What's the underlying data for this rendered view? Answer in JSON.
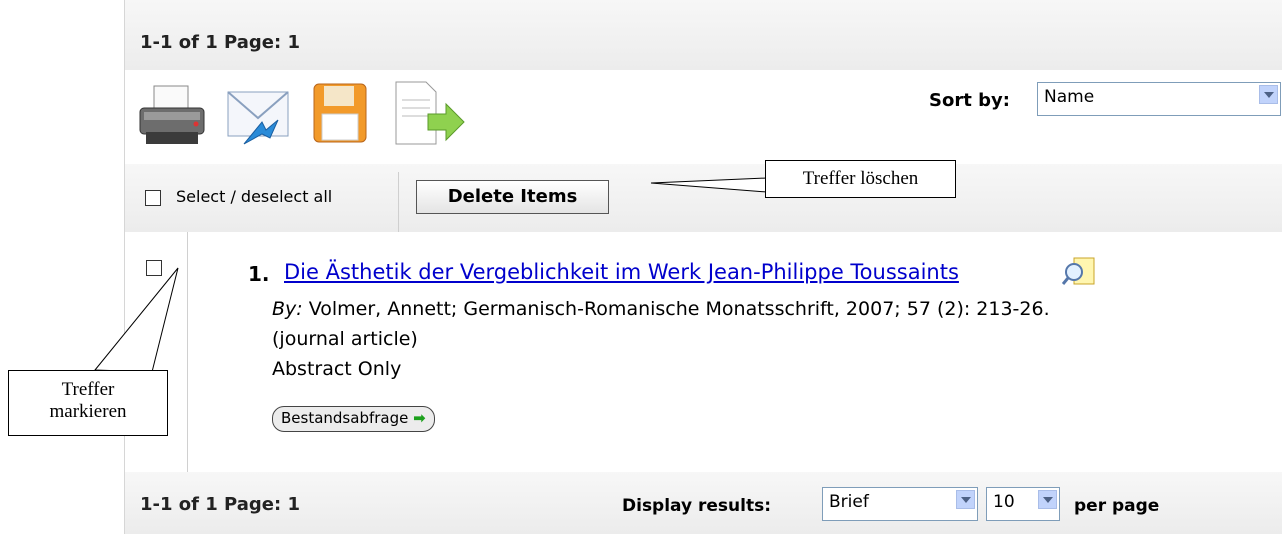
{
  "pager": {
    "top": "1-1 of 1  Page: 1",
    "bottom": "1-1 of 1  Page: 1"
  },
  "toolbar": {
    "icons": [
      "printer-icon",
      "email-icon",
      "save-icon",
      "export-icon"
    ],
    "sort_label": "Sort by:",
    "sort_value": "Name"
  },
  "selection": {
    "select_all_label": "Select / deselect all",
    "delete_label": "Delete Items"
  },
  "result": {
    "number": "1.",
    "title": "Die Ästhetik der Vergeblichkeit im Werk Jean-Philippe Toussaints",
    "by_label": "By:",
    "citation": " Volmer, Annett; Germanisch-Romanische Monatsschrift, 2007; 57 (2): 213-26.",
    "type": "(journal article)",
    "availability": "Abstract Only",
    "holdings_button": "Bestandsabfrage"
  },
  "footer": {
    "display_label": "Display results:",
    "display_value": "Brief",
    "per_page_value": "10",
    "per_page_label": "per page"
  },
  "callouts": {
    "delete": "Treffer löschen",
    "mark_line1": "Treffer",
    "mark_line2": "markieren"
  }
}
